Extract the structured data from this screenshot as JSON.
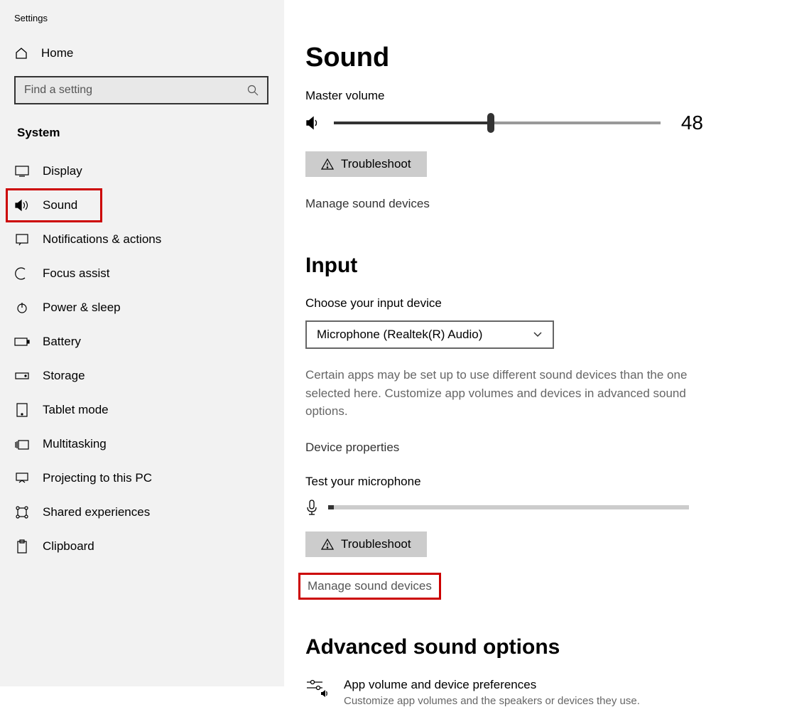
{
  "app_title": "Settings",
  "sidebar": {
    "home_label": "Home",
    "search_placeholder": "Find a setting",
    "section_label": "System",
    "items": [
      {
        "label": "Display"
      },
      {
        "label": "Sound"
      },
      {
        "label": "Notifications & actions"
      },
      {
        "label": "Focus assist"
      },
      {
        "label": "Power & sleep"
      },
      {
        "label": "Battery"
      },
      {
        "label": "Storage"
      },
      {
        "label": "Tablet mode"
      },
      {
        "label": "Multitasking"
      },
      {
        "label": "Projecting to this PC"
      },
      {
        "label": "Shared experiences"
      },
      {
        "label": "Clipboard"
      }
    ]
  },
  "main": {
    "title": "Sound",
    "master_volume_label": "Master volume",
    "master_volume_value": "48",
    "troubleshoot_label": "Troubleshoot",
    "manage_devices_label": "Manage sound devices",
    "input_heading": "Input",
    "choose_input_label": "Choose your input device",
    "input_device_selected": "Microphone (Realtek(R) Audio)",
    "input_help_text": "Certain apps may be set up to use different sound devices than the one selected here. Customize app volumes and devices in advanced sound options.",
    "device_properties_label": "Device properties",
    "test_mic_label": "Test your microphone",
    "advanced_heading": "Advanced sound options",
    "adv_item_title": "App volume and device preferences",
    "adv_item_sub": "Customize app volumes and the speakers or devices they use."
  }
}
